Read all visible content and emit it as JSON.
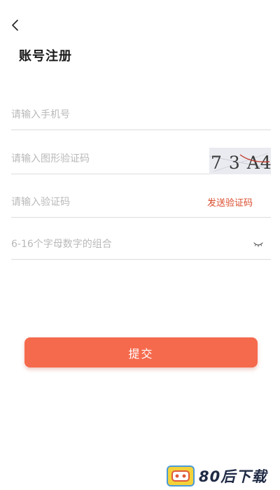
{
  "header": {
    "title": "账号注册"
  },
  "form": {
    "phone_placeholder": "请输入手机号",
    "captcha_placeholder": "请输入图形验证码",
    "captcha_text": "7 3 A4",
    "sms_placeholder": "请输入验证码",
    "send_code_label": "发送验证码",
    "password_placeholder": "6-16个字母数字的组合"
  },
  "submit": {
    "label": "提交"
  },
  "watermark": {
    "text": "80后下载"
  },
  "icons": {
    "back": "chevron-left-icon",
    "eye": "eye-closed-icon"
  },
  "colors": {
    "accent": "#f56a4d",
    "send_code": "#d94b2b",
    "placeholder": "#b9b9b9",
    "divider": "#dcdcdc"
  }
}
